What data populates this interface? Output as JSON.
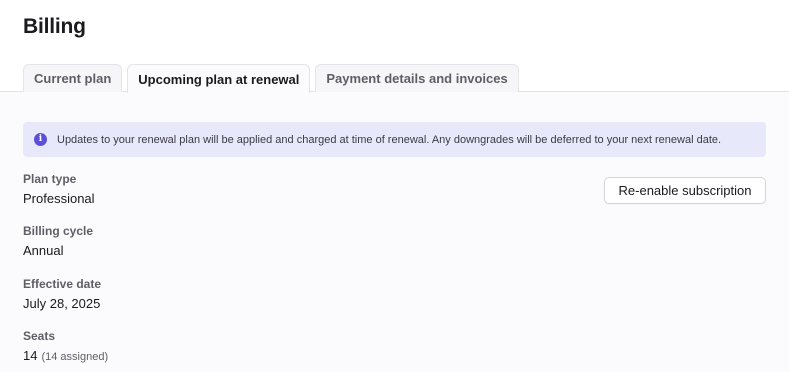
{
  "header": {
    "title": "Billing",
    "tabs": [
      {
        "label": "Current plan",
        "active": false
      },
      {
        "label": "Upcoming plan at renewal",
        "active": true
      },
      {
        "label": "Payment details and invoices",
        "active": false
      }
    ]
  },
  "banner": {
    "icon": "info-icon",
    "icon_glyph": "i",
    "text": "Updates to your renewal plan will be applied and charged at time of renewal. Any downgrades will be deferred to your next renewal date."
  },
  "fields": {
    "plan_type": {
      "label": "Plan type",
      "value": "Professional"
    },
    "billing_cycle": {
      "label": "Billing cycle",
      "value": "Annual"
    },
    "effective_date": {
      "label": "Effective date",
      "value": "July 28, 2025"
    },
    "seats": {
      "label": "Seats",
      "value": "14",
      "sub": "(14 assigned)"
    }
  },
  "actions": {
    "reenable_label": "Re-enable subscription"
  },
  "colors": {
    "accent": "#5b4fd6",
    "banner_bg": "#e8e8fb",
    "content_bg": "#fbfbfd"
  }
}
